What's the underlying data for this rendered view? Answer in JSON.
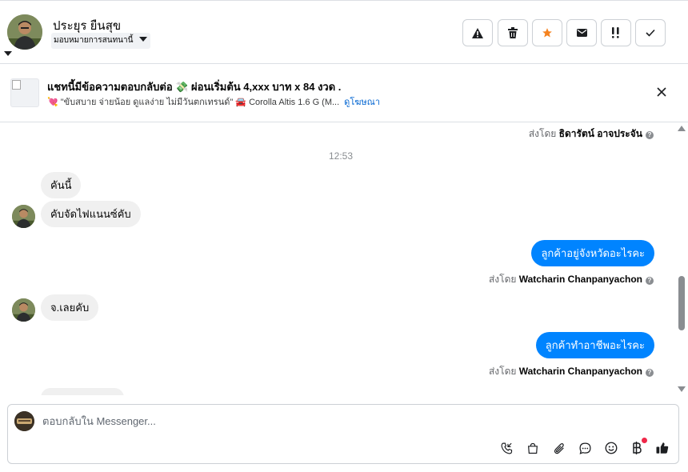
{
  "header": {
    "contact_name": "ประยุร ยืนสุข",
    "assign_label": "มอบหมายการสนทนานี้",
    "actions": [
      {
        "name": "report-spam",
        "icon": "warning-icon"
      },
      {
        "name": "delete",
        "icon": "trash-icon"
      },
      {
        "name": "star",
        "icon": "star-icon"
      },
      {
        "name": "mark-unread",
        "icon": "envelope-icon"
      },
      {
        "name": "follow-up",
        "icon": "exclamation-icon"
      },
      {
        "name": "mark-done",
        "icon": "check-icon"
      }
    ],
    "colors": {
      "star": "#f5821f"
    }
  },
  "ad": {
    "title": "แชทนี้มีข้อความตอบกลับต่อ 💸 ผ่อนเริ่มต้น 4,xxx บาท x 84 งวด .",
    "subtitle": "💘 \"ขับสบาย จ่ายน้อย ดูแลง่าย ไม่มีวันตกเทรนด์\" 🚘 Corolla Altis 1.6 G (M...",
    "tag": "ดูโฆษณา"
  },
  "conversation": {
    "top_sender_prefix": "ส่งโดย",
    "top_sender_name": "ธิดารัตน์ อาจประจัน",
    "timestamp": "12:53",
    "messages": [
      {
        "dir": "in",
        "text": "คันนี้"
      },
      {
        "dir": "in",
        "text": "คับจัดไฟแนนซ์คับ"
      },
      {
        "dir": "out",
        "text": "ลูกค้าอยู่จังหวัดอะไรคะ",
        "sender_prefix": "ส่งโดย",
        "sender": "Watcharin Chanpanyachon"
      },
      {
        "dir": "in",
        "text": "จ.เลยคับ"
      },
      {
        "dir": "out",
        "text": "ลูกค้าทำอาชีพอะไรคะ",
        "sender_prefix": "ส่งโดย",
        "sender": "Watcharin Chanpanyachon"
      }
    ]
  },
  "composer": {
    "placeholder": "ตอบกลับใน Messenger...",
    "tools": [
      "phone-icon",
      "shopping-bag-icon",
      "paperclip-icon",
      "chat-bubble-icon",
      "emoji-icon",
      "baht-icon",
      "thumbs-up-icon"
    ]
  },
  "colors": {
    "accent": "#0084ff",
    "incoming_bubble": "#f0f0f0",
    "badge": "#f02849"
  }
}
